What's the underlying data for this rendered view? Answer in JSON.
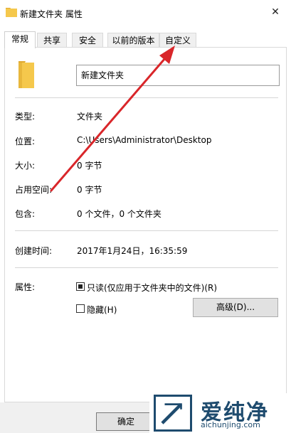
{
  "window": {
    "title": "新建文件夹 属性",
    "close_label": "✕"
  },
  "tabs": [
    {
      "label": "常规",
      "active": true
    },
    {
      "label": "共享",
      "active": false
    },
    {
      "label": "安全",
      "active": false
    },
    {
      "label": "以前的版本",
      "active": false
    },
    {
      "label": "自定义",
      "active": false
    }
  ],
  "general": {
    "folder_name": "新建文件夹",
    "rows": [
      {
        "label": "类型:",
        "value": "文件夹"
      },
      {
        "label": "位置:",
        "value": "C:\\Users\\Administrator\\Desktop"
      },
      {
        "label": "大小:",
        "value": "0 字节"
      },
      {
        "label": "占用空间:",
        "value": "0 字节"
      },
      {
        "label": "包含:",
        "value": "0 个文件，0 个文件夹"
      }
    ],
    "created": {
      "label": "创建时间:",
      "value": "2017年1月24日，16:35:59"
    },
    "attributes": {
      "label": "属性:",
      "readonly_label": "只读(仅应用于文件夹中的文件)(R)",
      "readonly_checked": true,
      "hidden_label": "隐藏(H)",
      "hidden_checked": false,
      "advanced_label": "高级(D)..."
    }
  },
  "footer": {
    "ok_label": "确定"
  },
  "watermark": {
    "brand": "爱纯净",
    "url": "aichunjing.com"
  },
  "colors": {
    "arrow": "#d9262a",
    "folder": "#f5c84c",
    "watermark": "#1e4b6e"
  }
}
